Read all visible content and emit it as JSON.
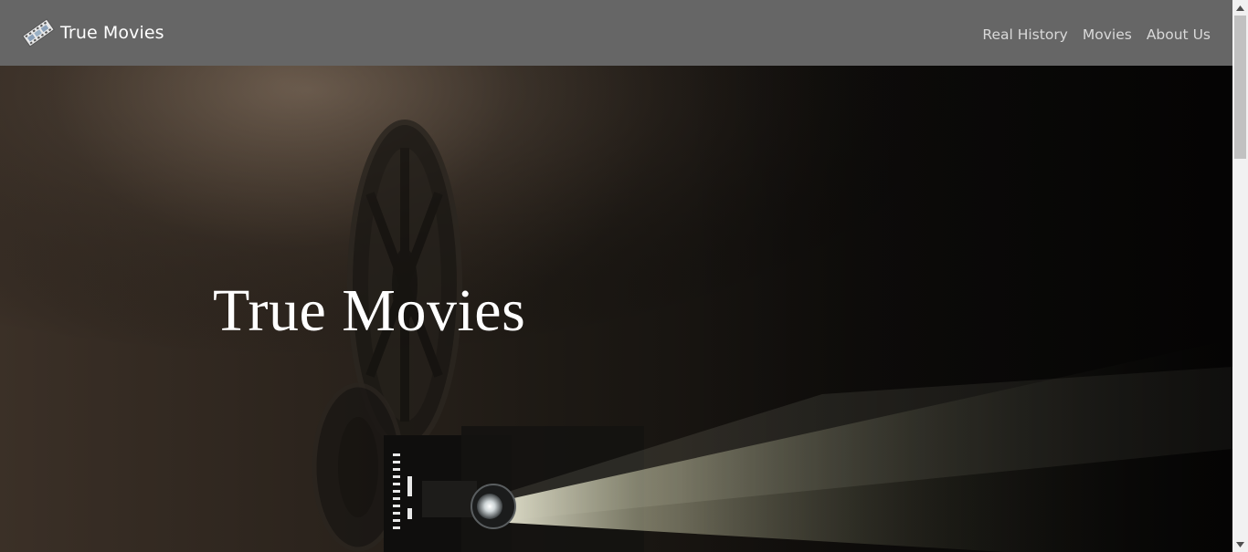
{
  "navbar": {
    "brand": {
      "logo_icon": "film-reel-icon",
      "label": "True Movies"
    },
    "links": [
      {
        "label": "Real History"
      },
      {
        "label": "Movies"
      },
      {
        "label": "About Us"
      }
    ],
    "background_color": "#666666"
  },
  "hero": {
    "title": "True Movies",
    "background_image": "film-projector-photo"
  },
  "scrollbar": {
    "up_icon": "chevron-up-icon",
    "down_icon": "chevron-down-icon"
  }
}
